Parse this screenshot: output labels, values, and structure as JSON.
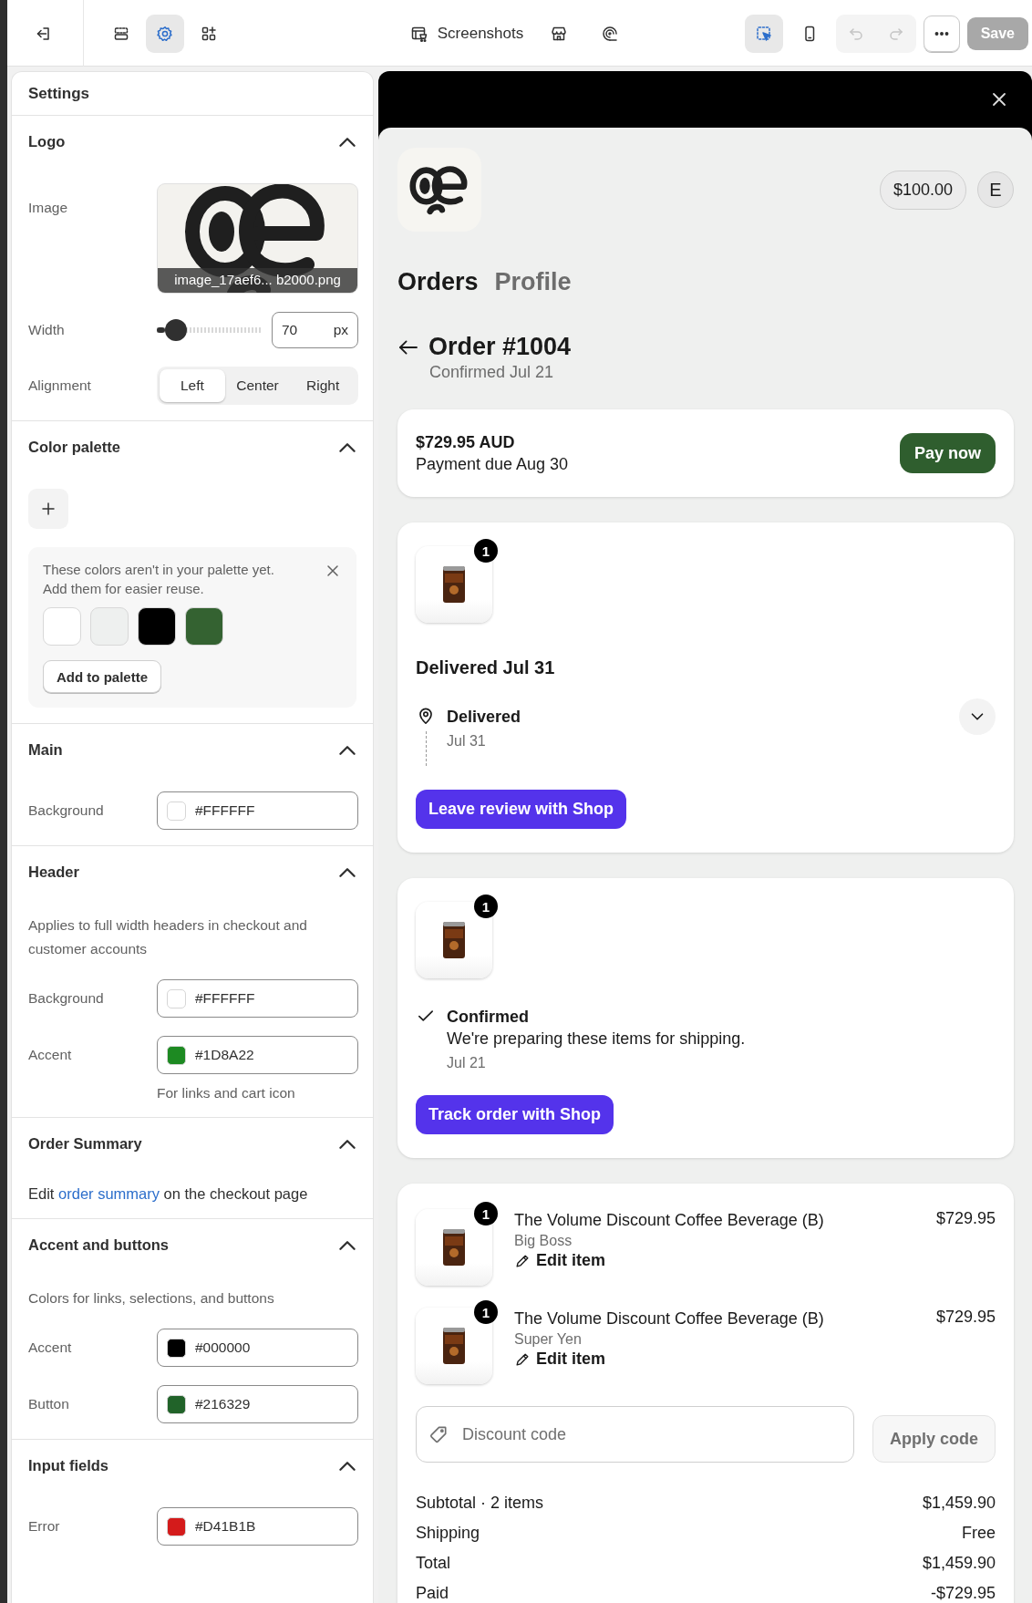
{
  "toolbar": {
    "title": "Screenshots",
    "left_tools": [
      {
        "kind": "layout",
        "selected": false
      },
      {
        "kind": "settings",
        "selected": true
      },
      {
        "kind": "apps",
        "selected": false
      }
    ],
    "right_tools": [
      {
        "kind": "inspector",
        "selected": true
      },
      {
        "kind": "mobile",
        "selected": false
      }
    ],
    "undo": {
      "disabled": true
    },
    "redo": {
      "disabled": true
    },
    "save": {
      "label": "Save",
      "disabled": true
    }
  },
  "settings": {
    "title": "Settings",
    "sections": [
      {
        "title": "Logo",
        "expanded": true,
        "rows": [
          {
            "kind": "image",
            "label": "Image",
            "filename": "image_17aef6... b2000.png"
          },
          {
            "kind": "slider",
            "label": "Width",
            "level": 0.1,
            "value": "70",
            "unit": "px"
          },
          {
            "kind": "segmented",
            "label": "Alignment",
            "options": [
              {
                "label": "Left",
                "selected": true
              },
              {
                "label": "Center",
                "selected": false
              },
              {
                "label": "Right",
                "selected": false
              }
            ]
          }
        ]
      },
      {
        "title": "Color palette",
        "expanded": true,
        "rows": [
          {
            "kind": "add"
          },
          {
            "kind": "notice",
            "text": "These colors aren't in your palette yet. Add them for easier reuse.",
            "swatches": [
              {
                "color": "#ffffff"
              },
              {
                "color": "#eef0ef"
              },
              {
                "color": "#000000"
              },
              {
                "color": "#346231"
              }
            ],
            "button": "Add to palette"
          }
        ]
      },
      {
        "title": "Main",
        "expanded": true,
        "rows": [
          {
            "kind": "color",
            "label": "Background",
            "value": "#FFFFFF",
            "color": "#ffffff"
          }
        ]
      },
      {
        "title": "Header",
        "expanded": true,
        "rows": [
          {
            "kind": "description",
            "text": "Applies to full width headers in checkout and customer accounts"
          },
          {
            "kind": "color",
            "label": "Background",
            "value": "#FFFFFF",
            "color": "#ffffff"
          },
          {
            "kind": "color",
            "label": "Accent",
            "value": "#1D8A22",
            "color": "#1d8a22"
          },
          {
            "kind": "hint",
            "text": "For links and cart icon"
          }
        ]
      },
      {
        "title": "Order Summary",
        "expanded": true,
        "rows": [
          {
            "kind": "link_text",
            "before": "Edit ",
            "link": "order summary",
            "after": " on the checkout page"
          }
        ]
      },
      {
        "title": "Accent and buttons",
        "expanded": true,
        "rows": [
          {
            "kind": "description",
            "text": "Colors for links, selections, and buttons"
          },
          {
            "kind": "color",
            "label": "Accent",
            "value": "#000000",
            "color": "#000000"
          },
          {
            "kind": "color",
            "label": "Button",
            "value": "#216329",
            "color": "#216329"
          }
        ]
      },
      {
        "title": "Input fields",
        "expanded": true,
        "rows": [
          {
            "kind": "color",
            "label": "Error",
            "value": "#D41B1B",
            "color": "#d41b1b"
          }
        ]
      }
    ]
  },
  "preview": {
    "balance": "$100.00",
    "avatar": "E",
    "tabs": [
      {
        "label": "Orders",
        "selected": true
      },
      {
        "label": "Profile",
        "selected": false
      }
    ],
    "order": {
      "title": "Order #1004",
      "subtitle": "Confirmed Jul 21"
    },
    "payment": {
      "amount": "$729.95 AUD",
      "due": "Payment due Aug 30",
      "button": "Pay now"
    },
    "shipments": [
      {
        "quantity": "1",
        "heading": "Delivered Jul 31",
        "status": {
          "kind": "delivered",
          "title": "Delivered",
          "date": "Jul 31"
        },
        "button": "Leave review with Shop"
      },
      {
        "quantity": "1",
        "status": {
          "kind": "confirmed",
          "title": "Confirmed",
          "message": "We're preparing these items for shipping.",
          "date": "Jul 21"
        },
        "button": "Track order with Shop"
      }
    ],
    "items": [
      {
        "quantity": "1",
        "name": "The Volume Discount Coffee Beverage (B)",
        "variant": "Big Boss",
        "edit": "Edit item",
        "price": "$729.95"
      },
      {
        "quantity": "1",
        "name": "The Volume Discount Coffee Beverage (B)",
        "variant": "Super Yen",
        "edit": "Edit item",
        "price": "$729.95"
      }
    ],
    "discount": {
      "placeholder": "Discount code",
      "button": "Apply code"
    },
    "totals": [
      {
        "label": "Subtotal · 2 items",
        "value": "$1,459.90"
      },
      {
        "label": "Shipping",
        "value": "Free"
      },
      {
        "label": "Total",
        "value": "$1,459.90"
      },
      {
        "label": "Paid",
        "value": "-$729.95"
      }
    ]
  }
}
